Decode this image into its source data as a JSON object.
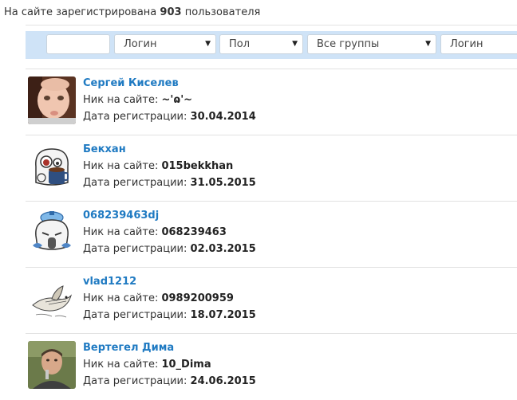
{
  "summary": {
    "prefix": "На сайте зарегистрирована",
    "count": "903",
    "suffix": "пользователя"
  },
  "filters": {
    "search_value": "",
    "sort_login": "Логин",
    "gender": "Пол",
    "groups": "Все группы",
    "login": "Логин"
  },
  "labels": {
    "nick": "Ник на сайте:",
    "reg_date": "Дата регистрации:"
  },
  "users": [
    {
      "name": "Сергей Киселев",
      "nick": "~'ɷ'~",
      "date": "30.04.2014",
      "avatar": "baby-photo"
    },
    {
      "name": "Бекхан",
      "nick": "015bekkhan",
      "date": "31.05.2015",
      "avatar": "cartoon-coffee"
    },
    {
      "name": "068239463dj",
      "nick": "068239463",
      "date": "02.03.2015",
      "avatar": "cartoon-icepack"
    },
    {
      "name": "vlad1212",
      "nick": "0989200959",
      "date": "18.07.2015",
      "avatar": "bird-drawing"
    },
    {
      "name": "Вертегел Дима",
      "nick": "10_Dima",
      "date": "24.06.2015",
      "avatar": "man-photo"
    }
  ]
}
